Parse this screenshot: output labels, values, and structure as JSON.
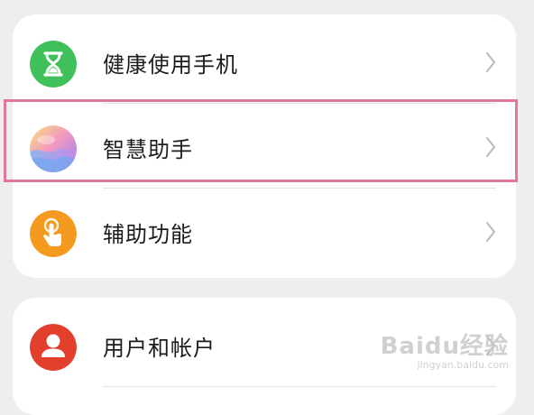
{
  "settings_list": {
    "group1": [
      {
        "label": "健康使用手机",
        "icon": "hourglass-icon",
        "icon_color": "#3fc05a"
      },
      {
        "label": "智慧助手",
        "icon": "assistant-orb-icon",
        "icon_color": "#b78ce6"
      },
      {
        "label": "辅助功能",
        "icon": "hand-tap-icon",
        "icon_color": "#f39a1f"
      }
    ],
    "group2": [
      {
        "label": "用户和帐户",
        "icon": "user-icon",
        "icon_color": "#e23f2c"
      }
    ]
  },
  "highlight": {
    "target": "智慧助手",
    "color": "#e2779c"
  },
  "watermark": {
    "main": "Baidu经验",
    "sub": "jingyan.baidu.com"
  }
}
